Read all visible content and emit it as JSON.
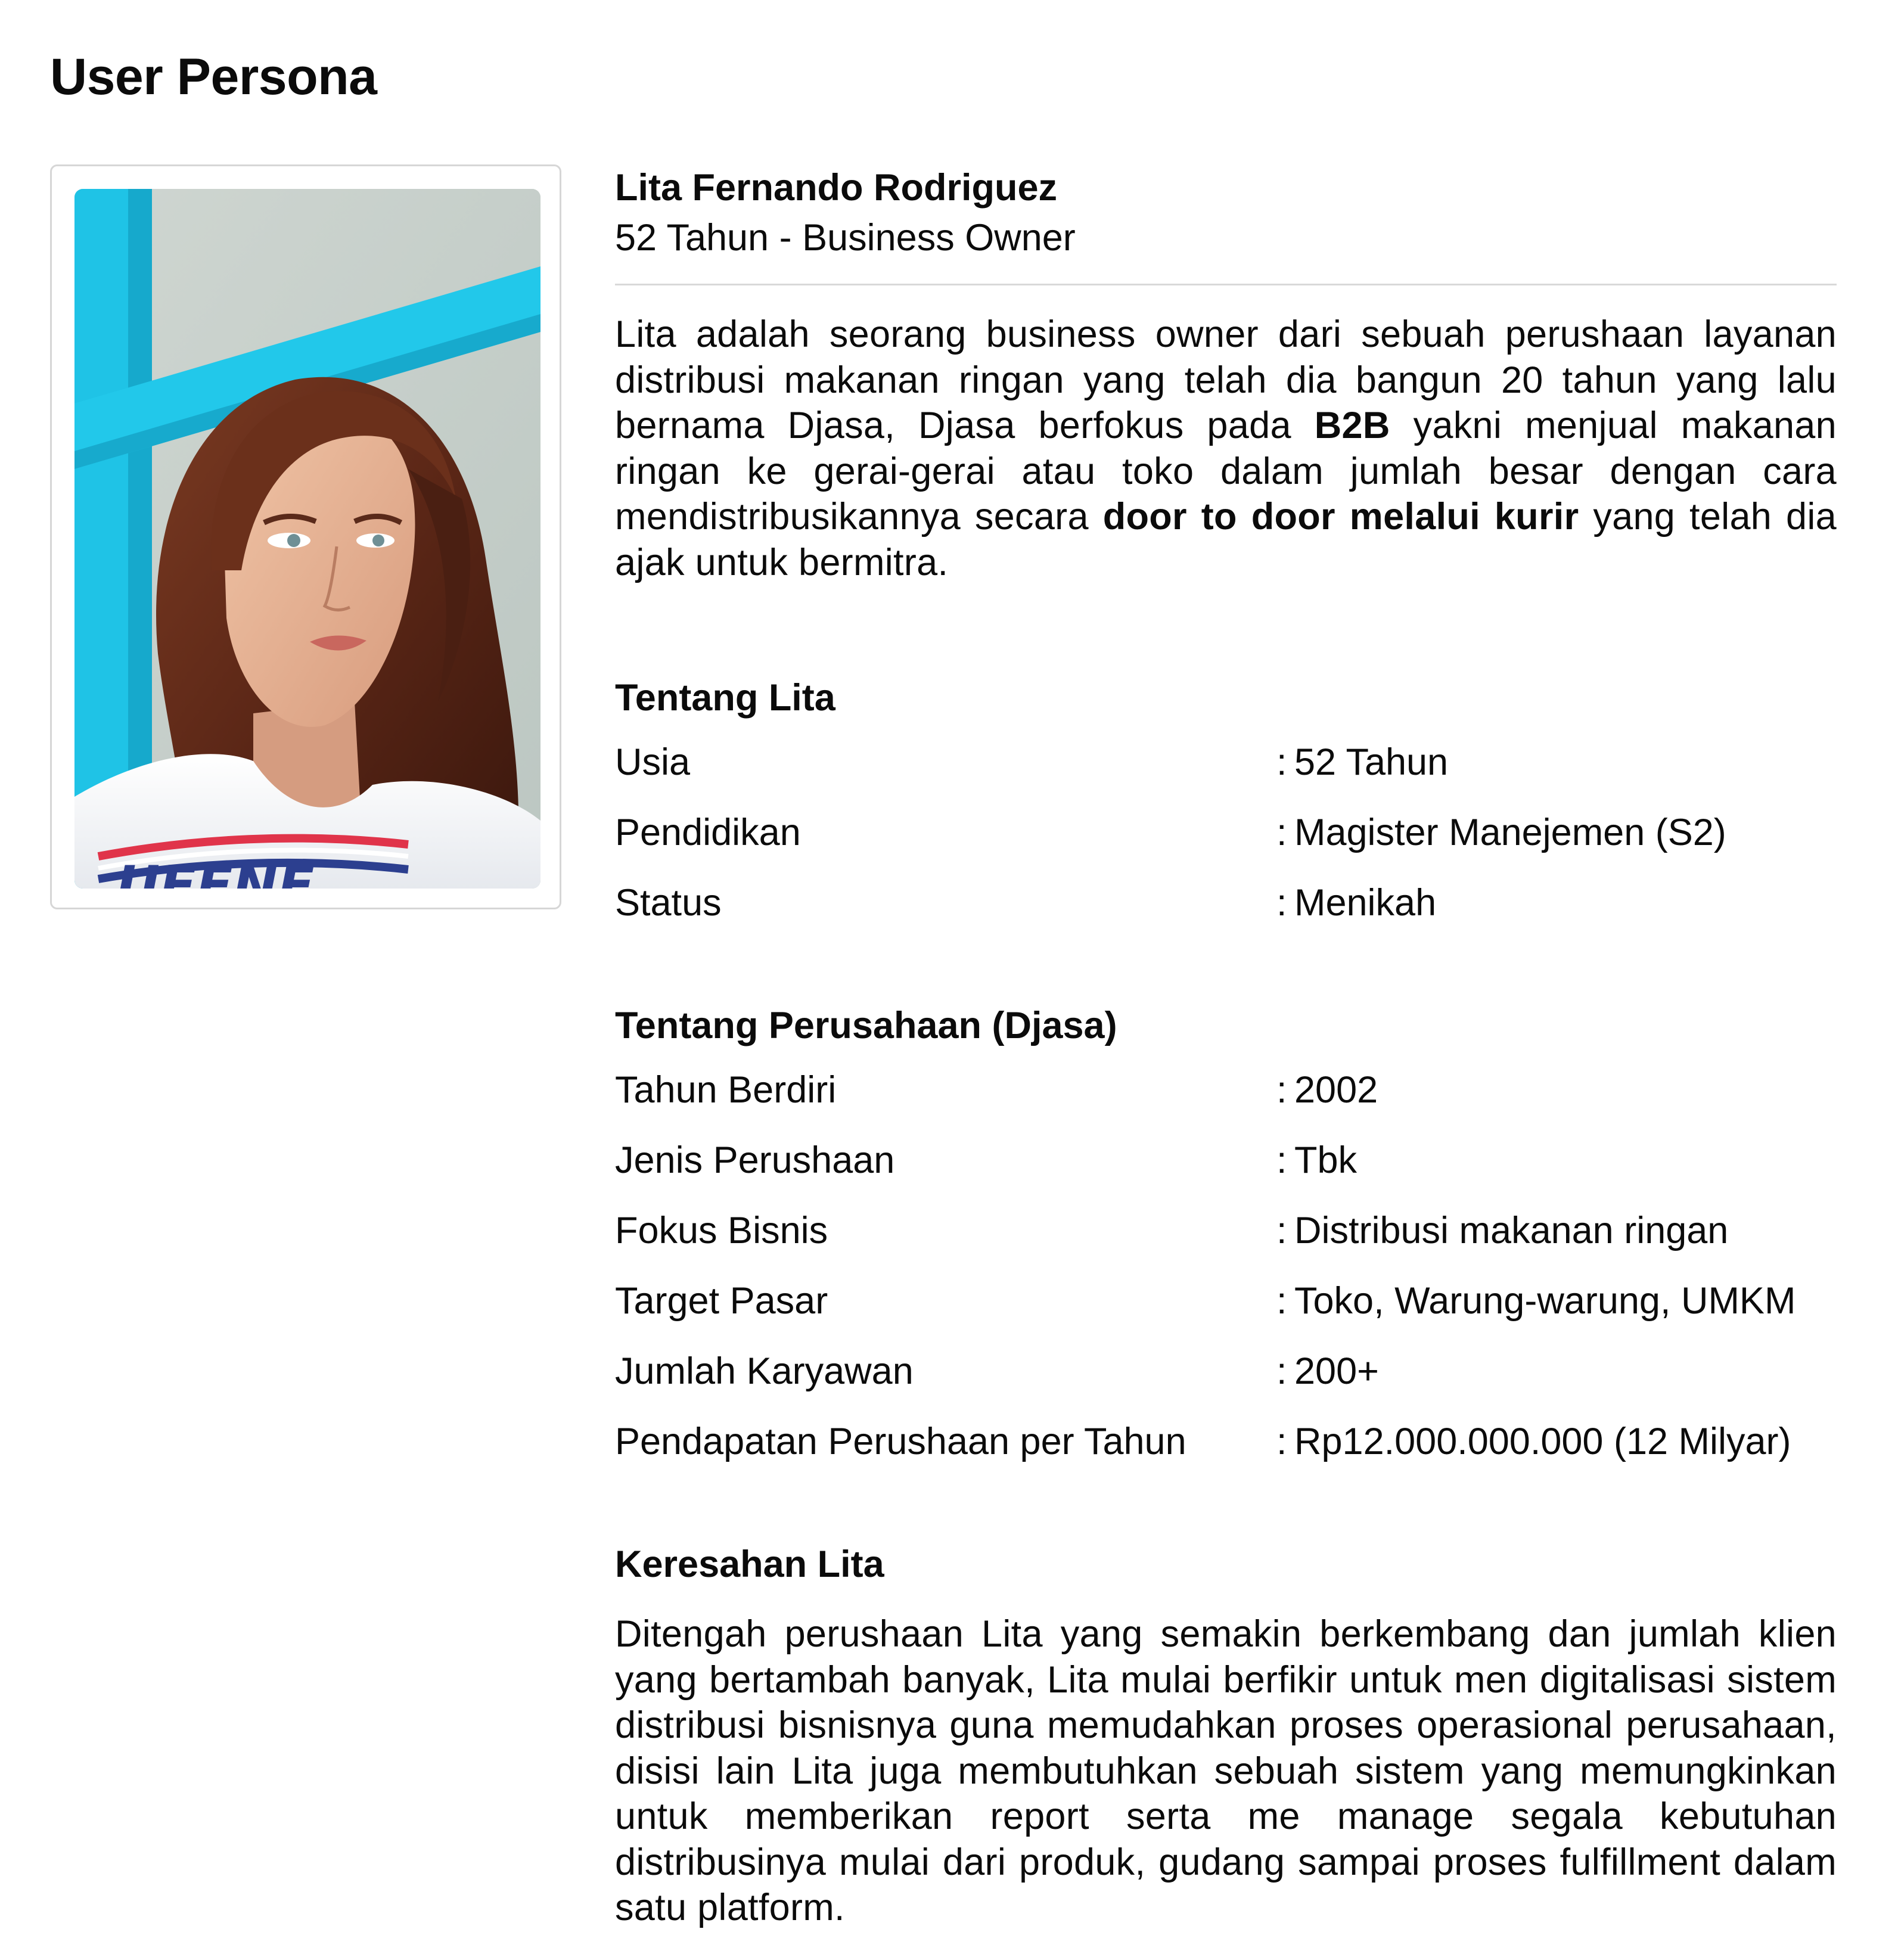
{
  "page": {
    "title": "User Persona"
  },
  "photo": {
    "alt": "Portrait photo of persona",
    "shirt_text": "UEENE"
  },
  "persona": {
    "name": "Lita Fernando Rodriguez",
    "role": "52 Tahun - Business Owner",
    "description": {
      "p1": "Lita adalah seorang business owner dari sebuah perushaan layanan distribusi makanan ringan yang telah dia bangun 20 tahun yang lalu bernama Djasa, Djasa berfokus pada ",
      "b1": "B2B",
      "p2": " yakni menjual makanan ringan ke gerai-gerai atau toko dalam jumlah besar dengan cara mendistribusikannya secara ",
      "b2": "door to door melalui kurir",
      "p3": " yang telah dia ajak untuk bermitra."
    }
  },
  "about_lita": {
    "title": "Tentang Lita",
    "rows": [
      {
        "label": "Usia",
        "value": "52 Tahun"
      },
      {
        "label": "Pendidikan",
        "value": "Magister Manejemen (S2)"
      },
      {
        "label": "Status",
        "value": "Menikah"
      }
    ]
  },
  "about_company": {
    "title": "Tentang Perusahaan (Djasa)",
    "rows": [
      {
        "label": "Tahun Berdiri",
        "value": "2002"
      },
      {
        "label": "Jenis Perushaan",
        "value": "Tbk"
      },
      {
        "label": "Fokus Bisnis",
        "value": "Distribusi makanan ringan"
      },
      {
        "label": "Target Pasar",
        "value": "Toko, Warung-warung, UMKM"
      },
      {
        "label": "Jumlah Karyawan",
        "value": "200+"
      },
      {
        "label": "Pendapatan Perushaan per Tahun",
        "value": "Rp12.000.000.000 (12 Milyar)"
      }
    ]
  },
  "concerns": {
    "title": "Keresahan Lita",
    "text": "Ditengah perushaan Lita yang semakin berkembang dan jumlah klien yang bertambah banyak, Lita mulai berfikir untuk men digitalisasi sistem distribusi bisnisnya guna memudahkan proses operasional perusahaan, disisi lain Lita juga membutuhkan sebuah sistem yang memungkinkan untuk memberikan report serta me manage segala kebutuhan distribusinya mulai dari produk, gudang sampai proses fulfillment dalam satu platform."
  },
  "separator": ":"
}
